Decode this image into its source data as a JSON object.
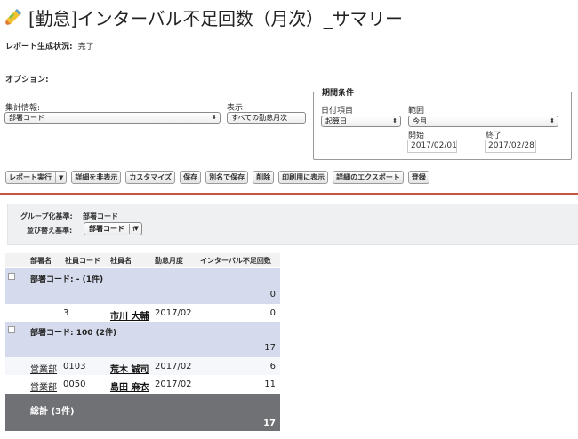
{
  "page": {
    "title": "[勤怠]インターバル不足回数（月次）_サマリー",
    "status_label": "レポート生成状況:",
    "status_value": "完了"
  },
  "options": {
    "label": "オプション:",
    "summary": {
      "label": "集計情報:",
      "value": "部署コード"
    },
    "display": {
      "label": "表示",
      "value": "すべての勤怠月次"
    },
    "period": {
      "legend": "期間条件",
      "date_field_label": "日付項目",
      "date_field_value": "起算日",
      "range_label": "範囲",
      "range_value": "今月",
      "start_label": "開始",
      "start_value": "2017/02/01",
      "end_label": "終了",
      "end_value": "2017/02/28"
    }
  },
  "toolbar": {
    "run_report": "レポート実行",
    "hide_details": "詳細を非表示",
    "customize": "カスタマイズ",
    "save": "保存",
    "save_as": "別名で保存",
    "delete": "削除",
    "printable_view": "印刷用に表示",
    "export_details": "詳細のエクスポート",
    "subscribe": "登録"
  },
  "grouping": {
    "group_by_label": "グループ化基準:",
    "group_by_value": "部署コード",
    "sort_by_label": "並び替え基準:",
    "sort_by_value": "部署コード",
    "sort_arrow": "↑"
  },
  "table": {
    "columns": [
      "部署名",
      "社員コード",
      "社員名",
      "勤怠月度",
      "インターバル不足回数"
    ],
    "groups": [
      {
        "title": "部署コード: - (1件)",
        "subtotal": "0",
        "rows": [
          {
            "dept": "",
            "code": "3",
            "name": "市川 大輔",
            "month": "2017/02",
            "count": "0"
          }
        ]
      },
      {
        "title": "部署コード: 100 (2件)",
        "subtotal": "17",
        "rows": [
          {
            "dept": "営業部",
            "code": "0103",
            "name": "荒木 誠司",
            "month": "2017/02",
            "count": "6"
          },
          {
            "dept": "営業部",
            "code": "0050",
            "name": "島田 麻衣",
            "month": "2017/02",
            "count": "11"
          }
        ]
      }
    ],
    "total_title": "総計 (3件)",
    "total_value": "17"
  }
}
